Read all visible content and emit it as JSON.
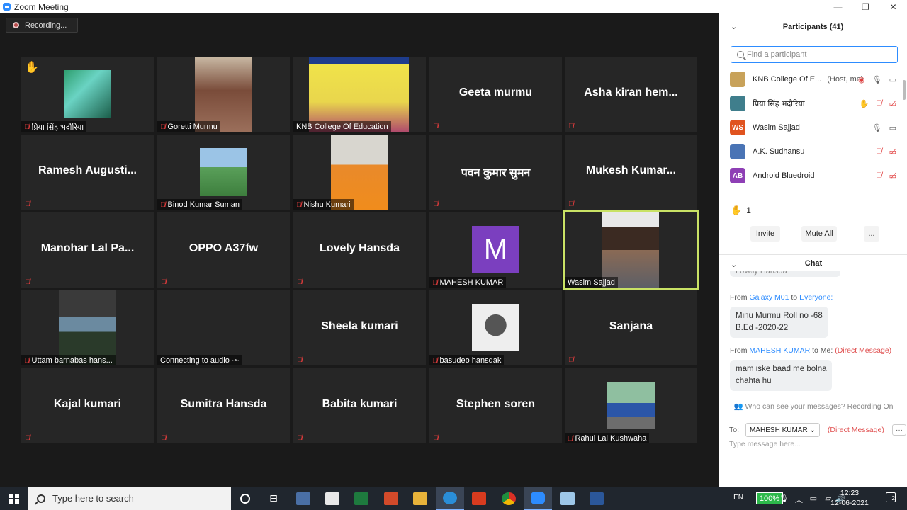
{
  "window": {
    "title": "Zoom Meeting"
  },
  "recording": {
    "label": "Recording..."
  },
  "tiles": [
    {
      "name": "प्रिया सिंह भदौरिया",
      "hand": "✋"
    },
    {
      "name": "Goretti Murmu"
    },
    {
      "name": "KNB College Of Education"
    },
    {
      "big": "Geeta murmu"
    },
    {
      "big": "Asha kiran hem..."
    },
    {
      "big": "Ramesh  Augusti..."
    },
    {
      "name": "Binod Kumar Suman"
    },
    {
      "name": "Nishu Kumari"
    },
    {
      "big": "पवन कुमार सुमन"
    },
    {
      "big": "Mukesh  Kumar..."
    },
    {
      "big": "Manohar Lal Pa..."
    },
    {
      "big": "OPPO A37fw"
    },
    {
      "big": "Lovely Hansda"
    },
    {
      "name": "MAHESH KUMAR",
      "letter": "M"
    },
    {
      "name": "Wasim Sajjad"
    },
    {
      "name": "Uttam barnabas hans..."
    },
    {
      "name": "Connecting to audio"
    },
    {
      "big": "Sheela kumari"
    },
    {
      "name": "basudeo hansdak"
    },
    {
      "big": "Sanjana"
    },
    {
      "big": "Kajal kumari"
    },
    {
      "big": "Sumitra Hansda"
    },
    {
      "big": "Babita kumari"
    },
    {
      "big": "Stephen soren"
    },
    {
      "name": "Rahul Lal Kushwaha"
    }
  ],
  "sidebar": {
    "participants_title": "Participants (41)",
    "search_placeholder": "Find a participant",
    "participants": [
      {
        "name": "KNB College Of E...",
        "note": "(Host, me)",
        "color": "#c8a25a",
        "initials": ""
      },
      {
        "name": "प्रिया सिंह भदौरिया",
        "note": "",
        "color": "#3f7e8c",
        "initials": ""
      },
      {
        "name": "Wasim Sajjad",
        "note": "",
        "color": "#e0531f",
        "initials": "WS"
      },
      {
        "name": "A.K. Sudhansu",
        "note": "",
        "color": "#4a74b5",
        "initials": ""
      },
      {
        "name": "Android Bluedroid",
        "note": "",
        "color": "#8e3fb5",
        "initials": "AB"
      }
    ],
    "raise_count": "1",
    "invite": "Invite",
    "mute_all": "Mute All",
    "more": "...",
    "chat_title": "Chat",
    "chat_prev": "Lovely Hansda",
    "messages": [
      {
        "from_label": "From",
        "sender": "Galaxy M01",
        "to_label": "to",
        "recipient": "Everyone:",
        "dm": "",
        "text1": "Minu Murmu Roll no -68",
        "text2": "B.Ed  -2020-22"
      },
      {
        "from_label": "From",
        "sender": "MAHESH KUMAR",
        "to_label": "to Me:",
        "recipient": "",
        "dm": "(Direct Message)",
        "text1": "mam iske baad me bolna",
        "text2": "chahta hu"
      }
    ],
    "who_can_see": "Who can see your messages? Recording On",
    "to_label": "To:",
    "to_value": "MAHESH KUMAR",
    "to_dm": "(Direct Message)",
    "message_placeholder": "Type message here..."
  },
  "taskbar": {
    "search_placeholder": "Type here to search",
    "lang": "EN",
    "battery": "100%",
    "time": "12:23",
    "date": "12-06-2021",
    "notifications": "2"
  }
}
